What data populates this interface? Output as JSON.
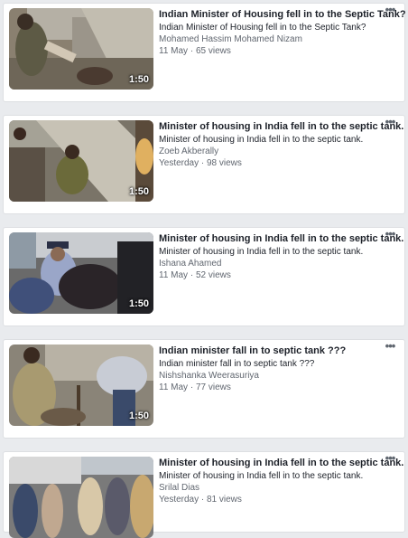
{
  "videos": [
    {
      "title": "Indian Minister of Housing fell in to the Septic Tank?",
      "description": "Indian Minister of Housing fell in to the Septic Tank?",
      "author": "Mohamed Hassim Mohamed Nizam",
      "date": "11 May",
      "views": "65 views",
      "duration": "1:50",
      "more_icon": "more-options-icon"
    },
    {
      "title": "Minister of housing in India fell in to the septic tank.",
      "description": "Minister of housing in India fell in to the septic tank.",
      "author": "Zoeb Akberally",
      "date": "Yesterday",
      "views": "98 views",
      "duration": "1:50",
      "more_icon": "more-options-icon"
    },
    {
      "title": "Minister of housing in India fell in to the septic tank.",
      "description": "Minister of housing in India fell in to the septic tank.",
      "author": "Ishana Ahamed",
      "date": "11 May",
      "views": "52 views",
      "duration": "1:50",
      "more_icon": "more-options-icon"
    },
    {
      "title": "Indian minister fall in to septic tank ???",
      "description": "Indian minister fall in to septic tank ???",
      "author": "Nishshanka Weerasuriya",
      "date": "11 May",
      "views": "77 views",
      "duration": "1:50",
      "more_icon": "more-options-icon"
    },
    {
      "title": "Minister of housing in India fell in to the septic tank.",
      "description": "Minister of housing in India fell in to the septic tank.",
      "author": "Srilal Dias",
      "date": "Yesterday",
      "views": "81 views",
      "duration": "",
      "more_icon": "more-options-icon"
    }
  ],
  "meta_separator": " · ",
  "more_label": "•••",
  "colors": {
    "page_background": "#e9ebee",
    "card_background": "#ffffff",
    "title_text": "#1d2129",
    "secondary_text": "#616770"
  }
}
